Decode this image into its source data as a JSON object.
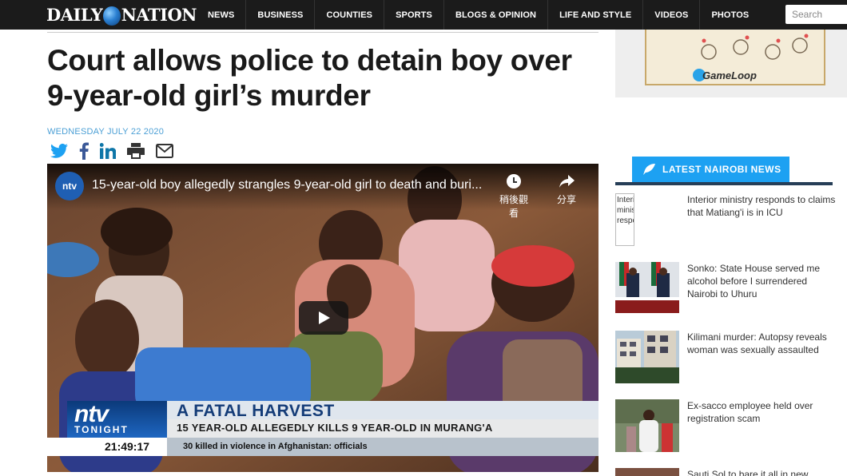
{
  "header": {
    "logo_left": "DAILY",
    "logo_right": "NATION",
    "nav": [
      "NEWS",
      "BUSINESS",
      "COUNTIES",
      "SPORTS",
      "BLOGS & OPINION",
      "LIFE AND STYLE",
      "VIDEOS",
      "PHOTOS"
    ],
    "search_placeholder": "Search"
  },
  "article": {
    "headline": "Court allows police to detain boy over 9-year-old girl’s murder",
    "date": "WEDNESDAY JULY 22 2020",
    "share_icons": [
      "twitter-icon",
      "facebook-icon",
      "linkedin-icon",
      "print-icon",
      "email-icon"
    ]
  },
  "video": {
    "channel_badge": "ntv",
    "title": "15-year-old boy allegedly strangles 9-year-old girl to death and buri...",
    "watch_later": "稍後觀看",
    "share": "分享",
    "lower_third": {
      "show_name": "ntv",
      "show_sub": "TONIGHT",
      "headline": "A FATAL HARVEST",
      "subheadline": "15 YEAR-OLD ALLEGEDLY KILLS 9 YEAR-OLD IN MURANG'A",
      "clock": "21:49:17",
      "ticker": "30 killed in violence in Afghanistan: officials"
    }
  },
  "sidebar": {
    "ad_brand": "GameLoop",
    "latest_label": "LATEST NAIROBI NEWS",
    "news": [
      {
        "title": "Interior ministry responds to claims that Matiang'i is in ICU",
        "thumb_alt": "Interior ministry responds"
      },
      {
        "title": "Sonko: State House served me alcohol before I surrendered Nairobi to Uhuru"
      },
      {
        "title": "Kilimani murder: Autopsy reveals woman was sexually assaulted"
      },
      {
        "title": "Ex-sacco employee held over registration scam"
      },
      {
        "title": "Sauti Sol to bare it all in new"
      }
    ]
  },
  "colors": {
    "nav_bg": "#1b1b1b",
    "accent_blue": "#1da1f2",
    "date_blue": "#4b9fd5",
    "latest_underline": "#263e57"
  }
}
